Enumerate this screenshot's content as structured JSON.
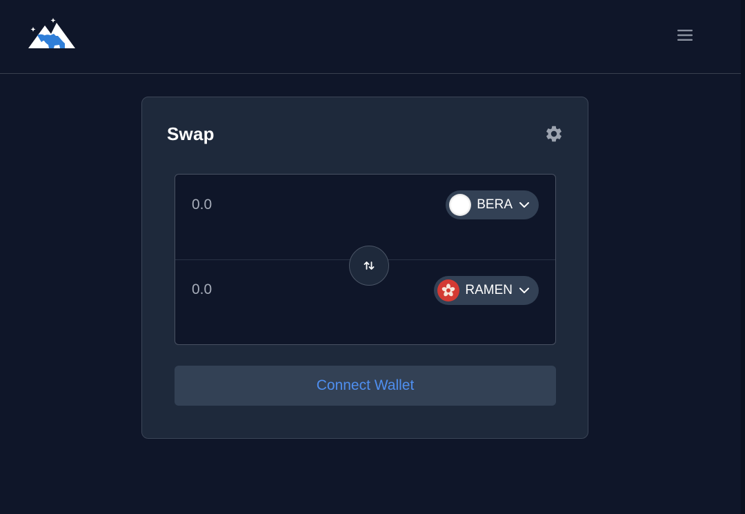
{
  "header": {
    "logo_icon": "mountain-bear-logo-icon",
    "menu_icon": "hamburger-menu-icon"
  },
  "swap": {
    "title": "Swap",
    "settings_icon": "gear-icon",
    "from": {
      "amount_placeholder": "0.0",
      "token": "BERA",
      "token_icon": "bera-token-icon"
    },
    "to": {
      "amount_placeholder": "0.0",
      "token": "RAMEN",
      "token_icon": "ramen-token-icon"
    },
    "flip_icon": "swap-arrows-icon",
    "connect_label": "Connect Wallet"
  },
  "colors": {
    "background": "#0f1629",
    "card": "#1e293b",
    "accent": "#4f8ff0",
    "button": "#334155"
  }
}
